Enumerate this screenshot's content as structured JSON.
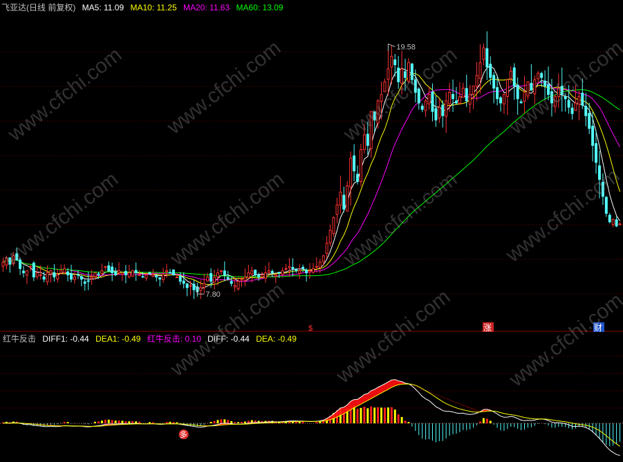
{
  "colors": {
    "ma5": "#ffffff",
    "ma10": "#ffff00",
    "ma20": "#ff00ff",
    "ma60": "#00ff00",
    "up": "#ff3232",
    "down": "#54ffff",
    "title": "#c0c0c0",
    "hongniu": "#ff00ff",
    "gridline": "#7a0000",
    "divider": "#8b0000"
  },
  "header": {
    "title": "飞亚达(日线 前复权)",
    "ma5": "MA5: 11.09",
    "ma10": "MA10: 11.25",
    "ma20": "MA20: 11.63",
    "ma60": "MA60: 13.09"
  },
  "subheader": {
    "title": "红牛反击",
    "diff1": "DIFF1: -0.44",
    "dea1": "DEA1: -0.49",
    "hongniu": "红牛反击: 0.10",
    "diff": "DIFF: -0.44",
    "dea": "DEA: -0.49"
  },
  "annotations": {
    "high": "19.58",
    "low": "7.80",
    "marker1": "$",
    "marker2": "涨",
    "marker3": "财",
    "sub_marker": "多"
  },
  "watermark": "www.cfchi.com",
  "chart_data": [
    {
      "type": "candlestick",
      "title": "飞亚达(日线 前复权)",
      "ylim": [
        6.5,
        21
      ],
      "annotations": [
        {
          "label": "19.58",
          "value": 19.58
        },
        {
          "label": "7.80",
          "value": 7.8
        }
      ],
      "close": [
        9.3,
        9.5,
        9.2,
        9.6,
        9.4,
        9.0,
        8.8,
        8.9,
        9.1,
        8.6,
        8.8,
        8.7,
        8.5,
        8.8,
        8.9,
        8.6,
        8.7,
        8.9,
        9.0,
        8.7,
        8.5,
        8.6,
        8.7,
        8.5,
        8.3,
        8.4,
        8.6,
        8.8,
        8.7,
        8.9,
        9.1,
        8.9,
        8.8,
        8.7,
        8.9,
        8.8,
        8.7,
        8.8,
        8.9,
        8.8,
        8.7,
        8.6,
        8.7,
        8.8,
        8.7,
        8.6,
        8.5,
        8.7,
        8.9,
        8.8,
        8.7,
        8.6,
        8.4,
        8.3,
        8.1,
        8.2,
        8.0,
        7.9,
        8.1,
        8.3,
        8.6,
        8.4,
        8.6,
        8.8,
        8.9,
        8.7,
        8.5,
        8.3,
        8.2,
        8.4,
        8.5,
        8.6,
        8.8,
        8.9,
        8.7,
        8.6,
        8.7,
        8.8,
        8.9,
        8.8,
        8.7,
        8.8,
        8.9,
        9.0,
        9.1,
        9.0,
        8.9,
        8.9,
        9.0,
        8.8,
        8.9,
        9.0,
        9.1,
        9.3,
        9.6,
        10.2,
        10.8,
        11.4,
        12.0,
        12.6,
        11.8,
        12.9,
        14.2,
        13.6,
        13.1,
        14.6,
        15.3,
        14.8,
        16.4,
        16.0,
        16.9,
        17.2,
        17.8,
        18.4,
        19.0,
        18.6,
        17.8,
        18.4,
        18.0,
        18.7,
        17.9,
        17.3,
        16.8,
        16.5,
        16.9,
        17.2,
        16.4,
        16.0,
        16.6,
        16.2,
        16.9,
        17.3,
        17.0,
        16.8,
        17.1,
        17.5,
        16.9,
        17.2,
        17.6,
        18.1,
        18.7,
        19.4,
        18.5,
        18.0,
        17.5,
        17.0,
        16.8,
        17.2,
        17.9,
        18.3,
        17.6,
        17.0,
        16.8,
        17.3,
        17.8,
        17.4,
        17.9,
        18.2,
        18.0,
        17.6,
        17.2,
        16.8,
        17.1,
        17.5,
        17.2,
        17.0,
        16.6,
        16.3,
        16.8,
        17.1,
        16.7,
        16.2,
        15.6,
        14.8,
        14.0,
        13.2,
        12.4,
        11.6,
        11.2,
        11.3,
        11.0,
        11.1
      ],
      "moving_averages": [
        {
          "name": "MA5",
          "value": 11.09,
          "period": 5
        },
        {
          "name": "MA10",
          "value": 11.25,
          "period": 10
        },
        {
          "name": "MA20",
          "value": 11.63,
          "period": 20
        },
        {
          "name": "MA60",
          "value": 13.09,
          "period": 60
        }
      ]
    },
    {
      "type": "bar",
      "title": "红牛反击",
      "series": [
        {
          "name": "DIFF1",
          "value": -0.44
        },
        {
          "name": "DEA1",
          "value": -0.49
        },
        {
          "name": "红牛反击",
          "value": 0.1
        },
        {
          "name": "DIFF",
          "value": -0.44
        },
        {
          "name": "DEA",
          "value": -0.49
        }
      ],
      "ylim": [
        -1.7,
        3.9
      ]
    }
  ]
}
